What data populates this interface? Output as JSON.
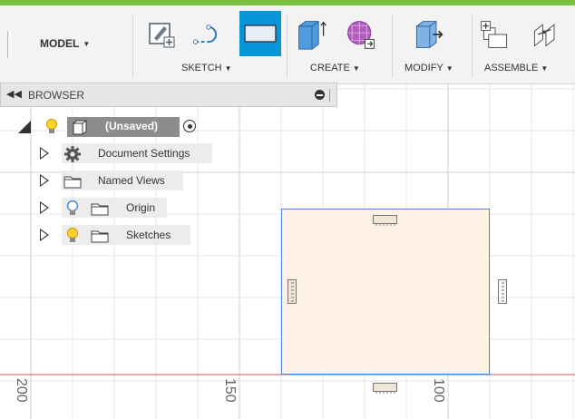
{
  "toolbar": {
    "workspace": "MODEL",
    "groups": [
      {
        "label": "SKETCH"
      },
      {
        "label": "CREATE"
      },
      {
        "label": "MODIFY"
      },
      {
        "label": "ASSEMBLE"
      }
    ],
    "icons": {
      "sketch": [
        "create-sketch-icon",
        "arc-line-icon",
        "rectangle-icon"
      ],
      "create": [
        "extrude-icon",
        "form-icon"
      ],
      "modify": [
        "press-pull-icon"
      ],
      "assemble": [
        "new-component-icon",
        "joint-icon"
      ]
    },
    "active_icon": "rectangle-icon",
    "accent_color": "#0696d7"
  },
  "browser": {
    "title": "BROWSER",
    "root": {
      "label": "(Unsaved)"
    },
    "items": [
      {
        "label": "Document Settings",
        "icon": "gear-icon"
      },
      {
        "label": "Named Views",
        "icon": "folder-icon"
      },
      {
        "label": "Origin",
        "icon": "folder-icon"
      },
      {
        "label": "Sketches",
        "icon": "folder-icon"
      }
    ]
  },
  "canvas": {
    "ruler_labels": [
      "200",
      "150",
      "100"
    ],
    "sketch_fill_color": "#fdf2e3",
    "sketch_stroke_color": "#4a86d6",
    "origin_axis_color": "#d9534f"
  }
}
